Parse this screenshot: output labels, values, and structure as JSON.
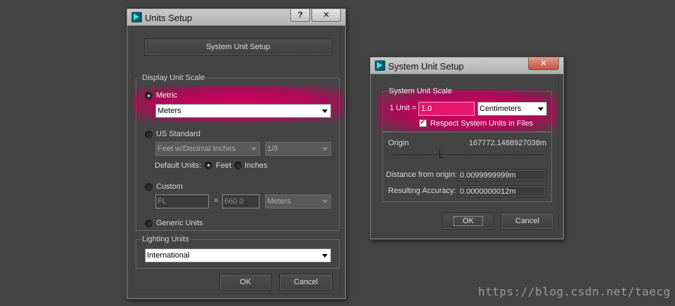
{
  "units_setup": {
    "title": "Units Setup",
    "help_label": "?",
    "close_label": "✕",
    "system_unit_setup_label": "System Unit Setup",
    "display_group_label": "Display Unit Scale",
    "metric_label": "Metric",
    "metric_value": "Meters",
    "us_standard_label": "US Standard",
    "us_unit_value": "Feet w/Decimal Inches",
    "us_fraction_value": "1/8",
    "default_units_label": "Default Units:",
    "feet_label": "Feet",
    "inches_label": "Inches",
    "custom_label": "Custom",
    "custom_name_value": "FL",
    "equals_label": "=",
    "custom_amount_value": "660.0",
    "custom_unit_value": "Meters",
    "generic_label": "Generic Units",
    "lighting_group_label": "Lighting Units",
    "lighting_value": "International",
    "ok_label": "OK",
    "cancel_label": "Cancel"
  },
  "system_unit_setup": {
    "title": "System Unit Setup",
    "close_label": "✕",
    "scale_group_label": "System Unit Scale",
    "unit_prefix_label": "1 Unit =",
    "unit_value": "1.0",
    "unit_type_value": "Centimeters",
    "respect_label": "Respect System Units in Files",
    "origin_label": "Origin",
    "origin_value": "167772.1488927038m",
    "distance_label": "Distance from origin:",
    "distance_value": "0.0099999999m",
    "accuracy_label": "Resulting Accuracy:",
    "accuracy_value": "0.0000000012m",
    "ok_label": "OK",
    "cancel_label": "Cancel"
  },
  "watermark_text": "https://blog.csdn.net/taecg",
  "colors": {
    "highlight": "#d6005f",
    "background": "#444444"
  }
}
